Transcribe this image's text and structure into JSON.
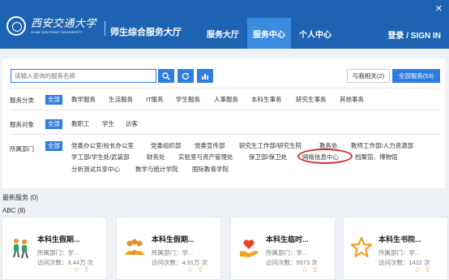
{
  "header": {
    "univ_cn": "西安交通大学",
    "univ_en": "XI'AN JIAOTONG UNIVERSITY",
    "site_title": "师生综合服务大厅",
    "nav": [
      "服务大厅",
      "服务中心",
      "个人中心"
    ],
    "active_nav": "服务中心",
    "login": "登录 / SIGN IN",
    "close": "✕",
    "bg_color": "#1e63b2",
    "active_color": "#3b8be0"
  },
  "search": {
    "placeholder": "请输入查询的服务名称",
    "buttons": [
      "search-icon",
      "refresh-icon",
      "chart-icon"
    ],
    "mine_label": "与我相关(2)",
    "all_label": "全部服务(53)"
  },
  "filters": {
    "category_label": "服务分类",
    "category": [
      "全部",
      "教学服务",
      "生活服务",
      "IT服务",
      "学生服务",
      "人事服务",
      "本科生事务",
      "研究生事务",
      "其他事务"
    ],
    "audience_label": "服务对象",
    "audience": [
      "全部",
      "教职工",
      "学生",
      "访客"
    ],
    "dept_label": "所属部门",
    "dept": [
      "全部",
      "党委办公室/校长办公室",
      "党委组织部",
      "党委宣传部",
      "研究生工作部/研究生院",
      "教务处",
      "教师工作部/人力资源部",
      "学工部/学生处/武装部",
      "财务处",
      "实验室与资产管理处",
      "保卫部/保卫处",
      "网络信息中心",
      "档案馆、博物馆",
      "分析测试共享中心",
      "数学与统计学院",
      "国际教育学院"
    ],
    "highlight": "网络信息中心",
    "accent": "#2f7de1",
    "highlight_color": "#d62d2d"
  },
  "sections": {
    "recent": "最新服务 (0)",
    "abc": "ABC (8)"
  },
  "services": [
    {
      "name": "本科生假期...",
      "dept": "所属部门：学...",
      "visits": "访问次数：3.44万 次",
      "icon": "hikers-icon"
    },
    {
      "name": "本科生假期...",
      "dept": "所属部门：学...",
      "visits": "访问次数：4.91万 次",
      "icon": "group-icon"
    },
    {
      "name": "本科生临时...",
      "dept": "所属部门：学...",
      "visits": "访问次数：5573 次",
      "icon": "heart-hand-icon"
    },
    {
      "name": "本科生书院...",
      "dept": "所属部门：学...",
      "visits": "访问次数：1422 次",
      "icon": "star-icon"
    }
  ]
}
